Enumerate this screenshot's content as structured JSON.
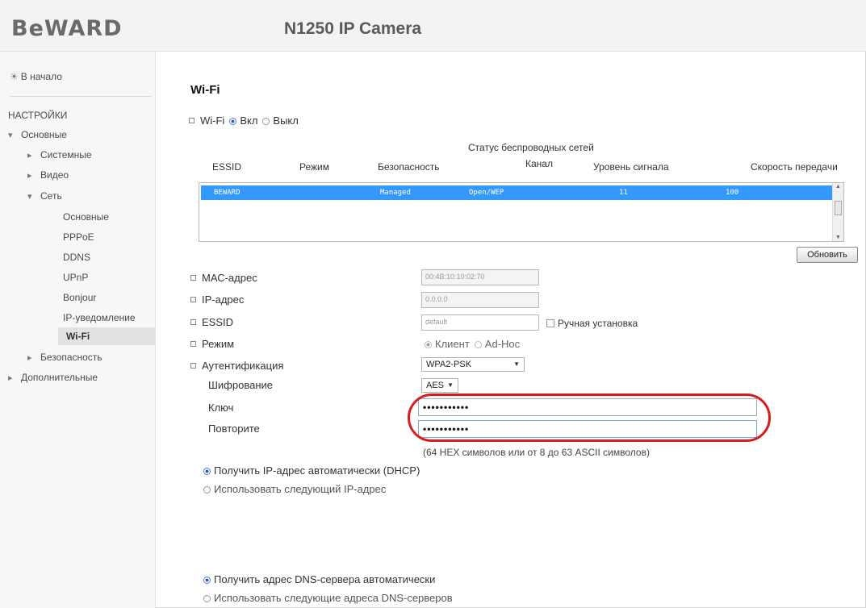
{
  "header": {
    "logo": "BeWARD",
    "camera_title": "N1250 IP Camera"
  },
  "sidebar": {
    "home": "В начало",
    "section_title": "НАСТРОЙКИ",
    "items": [
      {
        "label": "Основные"
      },
      {
        "label": "Системные"
      },
      {
        "label": "Видео"
      },
      {
        "label": "Сеть"
      },
      {
        "label": "Основные"
      },
      {
        "label": "PPPoE"
      },
      {
        "label": "DDNS"
      },
      {
        "label": "UPnP"
      },
      {
        "label": "Bonjour"
      },
      {
        "label": "IP-уведомление"
      },
      {
        "label": "Wi-Fi"
      },
      {
        "label": "Безопасность"
      },
      {
        "label": "Дополнительные"
      }
    ]
  },
  "main": {
    "title": "Wi-Fi",
    "wifi_toggle": {
      "label": "Wi-Fi",
      "on": "Вкл",
      "off": "Выкл",
      "value": "on"
    },
    "networks": {
      "caption": "Статус беспроводных сетей",
      "columns": [
        "ESSID",
        "Режим",
        "Безопасность",
        "Канал",
        "Уровень сигнала",
        "Скорость передачи"
      ],
      "rows": [
        {
          "essid": "BEWARD",
          "mode": "Managed",
          "security": "Open/WEP",
          "channel": "11",
          "signal": "100"
        }
      ],
      "refresh_button": "Обновить"
    },
    "fields": {
      "mac": {
        "label": "МАС-адрес",
        "value": "00:4B:10:10:02:70"
      },
      "ip": {
        "label": "IP-адрес",
        "value": "0.0.0.0"
      },
      "essid": {
        "label": "ESSID",
        "value": "default",
        "manual_label": "Ручная установка"
      },
      "mode": {
        "label": "Режим",
        "client": "Клиент",
        "adhoc": "Ad-Hoc",
        "value": "client"
      },
      "auth": {
        "label": "Аутентификация",
        "value": "WPA2-PSK"
      },
      "encryption": {
        "label": "Шифрование",
        "value": "AES"
      },
      "key": {
        "label": "Ключ",
        "value": "•••••••••••"
      },
      "repeat": {
        "label": "Повторите",
        "value": "•••••••••••"
      },
      "hint": "(64 HEX символов или от 8 до 63 ASCII символов)"
    },
    "ip_options": {
      "auto": "Получить IP-адрес автоматически (DHCP)",
      "manual": "Использовать следующий IP-адрес",
      "value": "auto"
    },
    "dns_options": {
      "auto": "Получить адрес DNS-сервера автоматически",
      "manual": "Использовать следующие адреса DNS-серверов",
      "value": "auto"
    }
  },
  "colors": {
    "selection": "#3399ff",
    "highlight": "#d81b1b"
  }
}
